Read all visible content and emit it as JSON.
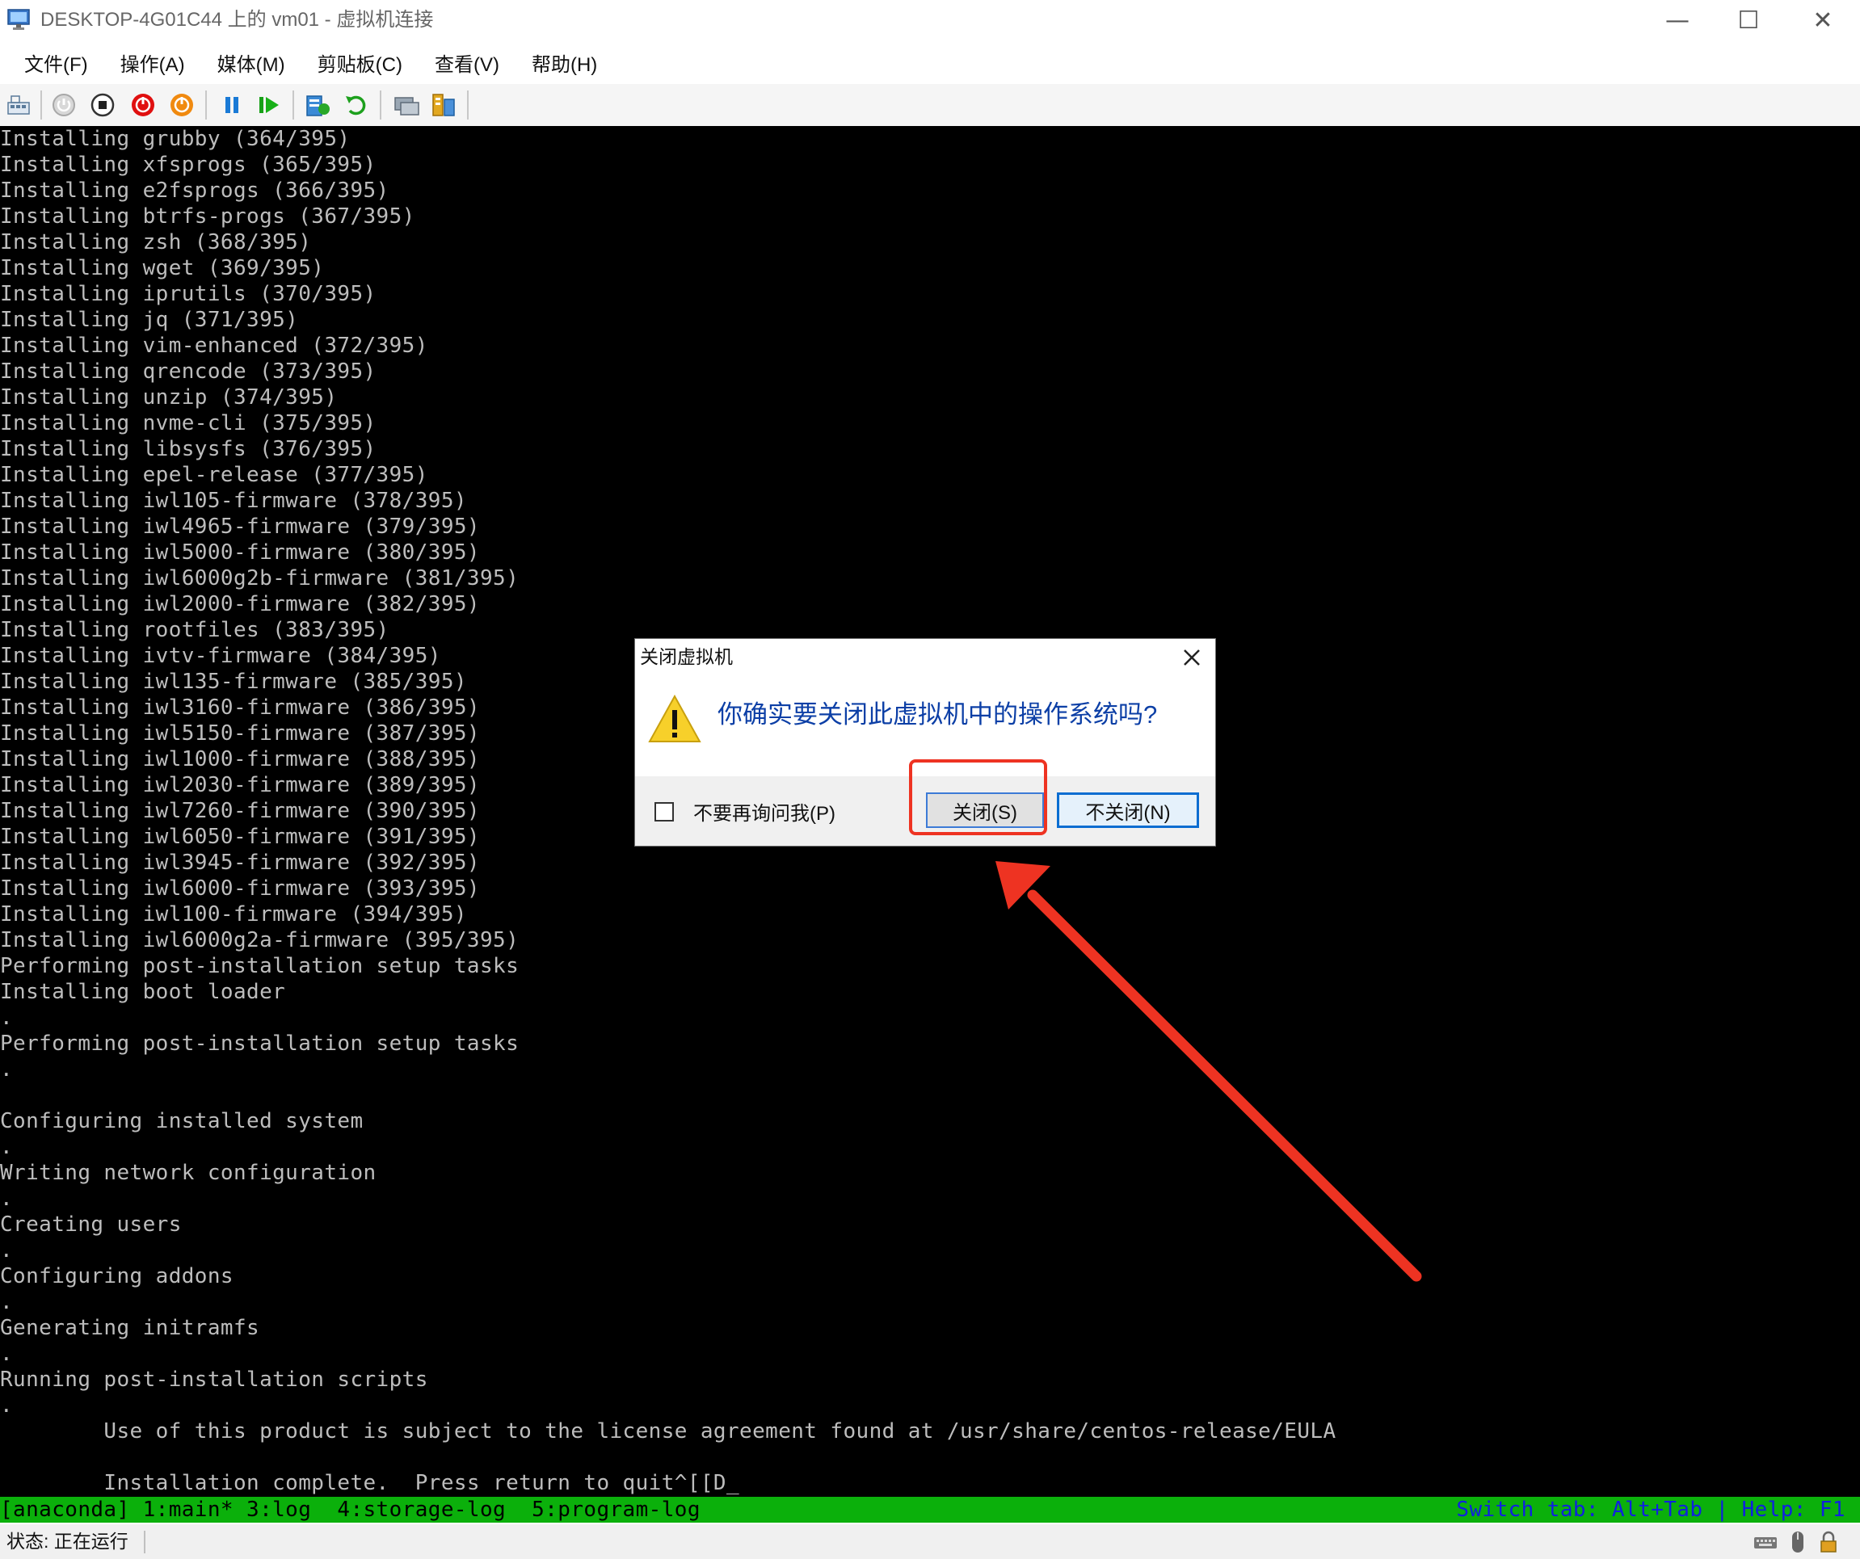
{
  "window": {
    "title": "DESKTOP-4G01C44 上的 vm01 - 虚拟机连接",
    "minimize_glyph": "—",
    "maximize_glyph": "☐",
    "close_glyph": "✕"
  },
  "menu": {
    "file": "文件(F)",
    "action": "操作(A)",
    "media": "媒体(M)",
    "clipboard": "剪贴板(C)",
    "view": "查看(V)",
    "help": "帮助(H)"
  },
  "toolbar": {
    "icons": [
      "ctrl-alt-del-icon",
      "start-icon",
      "turn-off-icon",
      "shutdown-icon",
      "save-icon",
      "pause-icon",
      "resume-icon",
      "checkpoint-icon",
      "revert-icon",
      "enhanced-session-icon",
      "share-icon"
    ]
  },
  "console": {
    "lines": [
      "Installing grubby (364/395)",
      "Installing xfsprogs (365/395)",
      "Installing e2fsprogs (366/395)",
      "Installing btrfs-progs (367/395)",
      "Installing zsh (368/395)",
      "Installing wget (369/395)",
      "Installing iprutils (370/395)",
      "Installing jq (371/395)",
      "Installing vim-enhanced (372/395)",
      "Installing qrencode (373/395)",
      "Installing unzip (374/395)",
      "Installing nvme-cli (375/395)",
      "Installing libsysfs (376/395)",
      "Installing epel-release (377/395)",
      "Installing iwl105-firmware (378/395)",
      "Installing iwl4965-firmware (379/395)",
      "Installing iwl5000-firmware (380/395)",
      "Installing iwl6000g2b-firmware (381/395)",
      "Installing iwl2000-firmware (382/395)",
      "Installing rootfiles (383/395)",
      "Installing ivtv-firmware (384/395)",
      "Installing iwl135-firmware (385/395)",
      "Installing iwl3160-firmware (386/395)",
      "Installing iwl5150-firmware (387/395)",
      "Installing iwl1000-firmware (388/395)",
      "Installing iwl2030-firmware (389/395)",
      "Installing iwl7260-firmware (390/395)",
      "Installing iwl6050-firmware (391/395)",
      "Installing iwl3945-firmware (392/395)",
      "Installing iwl6000-firmware (393/395)",
      "Installing iwl100-firmware (394/395)",
      "Installing iwl6000g2a-firmware (395/395)",
      "Performing post-installation setup tasks",
      "Installing boot loader",
      ".",
      "Performing post-installation setup tasks",
      ".",
      "",
      "Configuring installed system",
      ".",
      "Writing network configuration",
      ".",
      "Creating users",
      ".",
      "Configuring addons",
      ".",
      "Generating initramfs",
      ".",
      "Running post-installation scripts",
      ".",
      "        Use of this product is subject to the license agreement found at /usr/share/centos-release/EULA",
      "",
      "        Installation complete.  Press return to quit^[[D_"
    ]
  },
  "tmux": {
    "left": "[anaconda] 1:main* 3:log  4:storage-log  5:program-log",
    "right": "Switch tab: Alt+Tab | Help: F1"
  },
  "statusbar": {
    "status": "状态: 正在运行",
    "tray_icons": [
      "keyboard-icon",
      "mouse-icon",
      "lock-icon"
    ]
  },
  "dialog": {
    "title": "关闭虚拟机",
    "message": "你确实要关闭此虚拟机中的操作系统吗?",
    "checkbox_label": "不要再询问我(P)",
    "checkbox_checked": false,
    "close_button": "关闭(S)",
    "dont_close_button": "不关闭(N)"
  },
  "annotation": {
    "highlight_color": "#ee3322",
    "arrow_color": "#ee3322"
  }
}
